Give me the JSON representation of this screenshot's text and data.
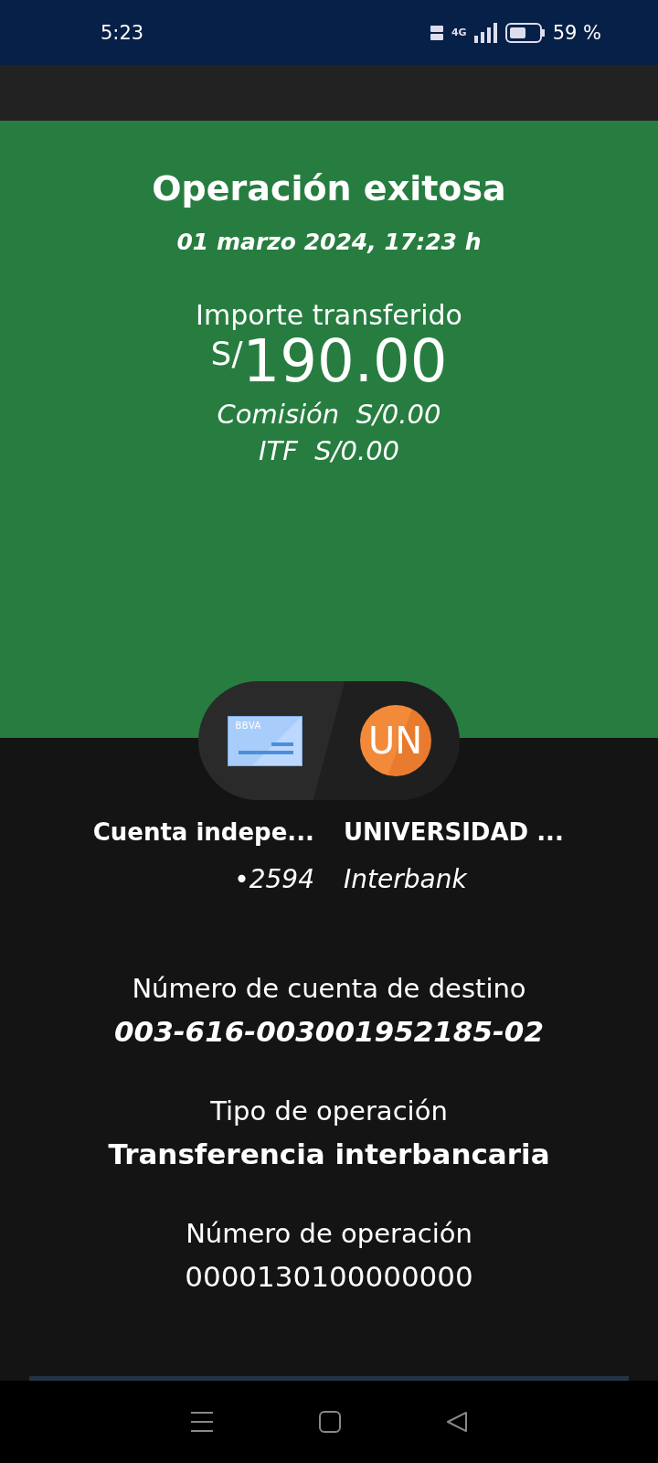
{
  "status_bar": {
    "time": "5:23",
    "network": "4G",
    "battery": "59 %"
  },
  "result": {
    "title": "Operación exitosa",
    "date": "01 marzo 2024, 17:23 h",
    "amount_label": "Importe transferido",
    "currency": "S/",
    "amount": "190.00",
    "commission": "Comisión  S/0.00",
    "itf": "ITF  S/0.00"
  },
  "origin": {
    "card_label": "BBVA",
    "name": "Cuenta indepe...",
    "account": "•2594"
  },
  "destination": {
    "initials": "UN",
    "name": "UNIVERSIDAD ...",
    "bank": "Interbank"
  },
  "details": [
    {
      "label": "Número de cuenta de destino",
      "value": "003-616-003001952185-02",
      "kind": "italic"
    },
    {
      "label": "Tipo de operación",
      "value": "Transferencia interbancaria",
      "kind": "bold"
    },
    {
      "label": "Número de operación",
      "value": "0000130100000000",
      "kind": "plain"
    }
  ]
}
